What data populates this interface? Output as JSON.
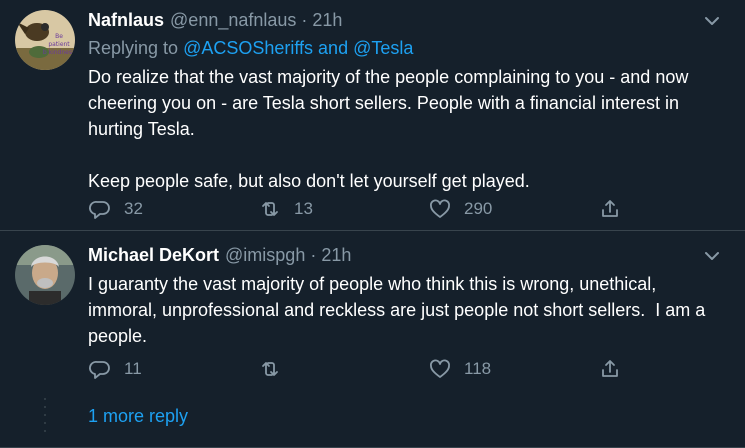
{
  "tweets": [
    {
      "name": "Nafnlaus",
      "handle": "@enn_nafnlaus",
      "separator": "·",
      "time": "21h",
      "replying_prefix": "Replying to ",
      "replying_mentions": "@ACSOSheriffs and @Tesla",
      "text": "Do realize that the vast majority of the people complaining to you - and now cheering you on - are Tesla short sellers. People with a financial interest in hurting Tesla.\n\nKeep people safe, but also don't let yourself get played.",
      "replies": "32",
      "retweets": "13",
      "likes": "290",
      "avatar_caption": "Be patient, b kindness"
    },
    {
      "name": "Michael DeKort",
      "handle": "@imispgh",
      "separator": "·",
      "time": "21h",
      "text": "I guaranty the vast majority of people who think this is wrong, unethical, immoral, unprofessional and reckless are just people not short sellers.  I am a people.",
      "replies": "11",
      "retweets": "",
      "likes": "118"
    }
  ],
  "more_replies": "1 more reply",
  "icons": [
    "caret-down-icon",
    "reply-icon",
    "retweet-icon",
    "like-icon",
    "share-icon"
  ],
  "colors": {
    "background": "#15202b",
    "text": "#ffffff",
    "secondary": "#8899a6",
    "link": "#1da1f2",
    "border": "#38444d"
  }
}
